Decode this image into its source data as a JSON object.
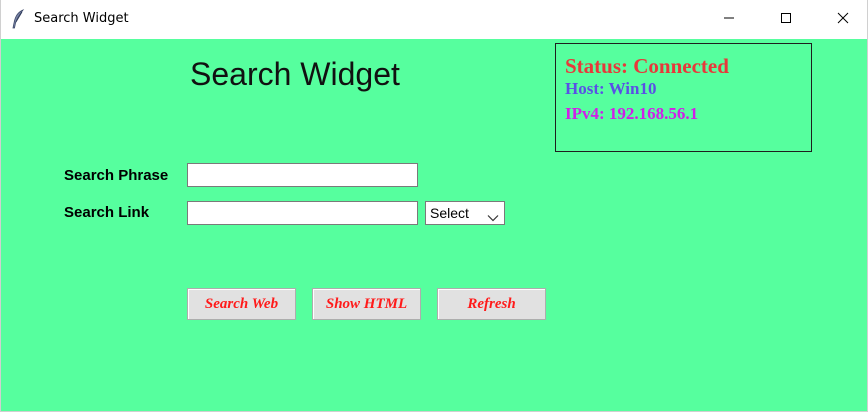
{
  "window": {
    "title": "Search Widget"
  },
  "main": {
    "heading": "Search Widget"
  },
  "status": {
    "connection": "Status: Connected",
    "host": "Host: Win10",
    "ipv4": "IPv4: 192.168.56.1",
    "connection_color": "#e8383a",
    "host_color": "#5a4fe6",
    "ipv4_color": "#d11ee8"
  },
  "form": {
    "search_phrase_label": "Search Phrase",
    "search_phrase_value": "",
    "search_link_label": "Search Link",
    "search_link_value": "",
    "link_select_value": "Select"
  },
  "actions": {
    "search_web": "Search Web",
    "show_html": "Show HTML",
    "refresh": "Refresh",
    "label_color": "#ff1a1a"
  },
  "theme": {
    "background": "#56ff9e"
  },
  "icons": {
    "app": "feather-icon",
    "minimize": "minimize-icon",
    "maximize": "maximize-icon",
    "close": "close-icon",
    "dropdown": "chevron-down-icon"
  }
}
